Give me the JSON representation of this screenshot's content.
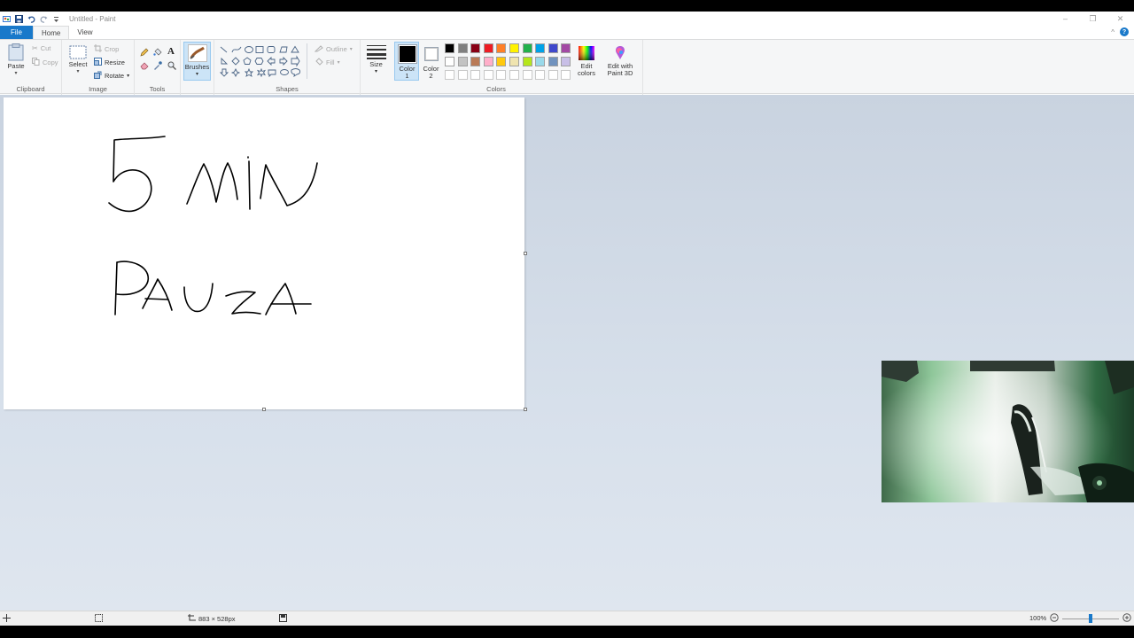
{
  "window": {
    "title": "Untitled - Paint"
  },
  "menu": {
    "file": "File",
    "home": "Home",
    "view": "View"
  },
  "clipboard": {
    "paste": "Paste",
    "cut": "Cut",
    "copy": "Copy",
    "label": "Clipboard"
  },
  "image": {
    "select": "Select",
    "crop": "Crop",
    "resize": "Resize",
    "rotate": "Rotate",
    "label": "Image"
  },
  "tools": {
    "label": "Tools"
  },
  "brushes": {
    "label": "Brushes"
  },
  "shapes": {
    "outline": "Outline",
    "fill": "Fill",
    "label": "Shapes"
  },
  "size": {
    "label": "Size"
  },
  "colors": {
    "color1_label": "Color",
    "color1_num": "1",
    "color2_label": "Color",
    "color2_num": "2",
    "edit_colors_l1": "Edit",
    "edit_colors_l2": "colors",
    "paint3d_l1": "Edit with",
    "paint3d_l2": "Paint 3D",
    "label": "Colors",
    "color1_value": "#000000",
    "color2_value": "#ffffff",
    "palette_row1": [
      "#000000",
      "#7f7f7f",
      "#880015",
      "#ed1c24",
      "#ff7f27",
      "#fff200",
      "#22b14c",
      "#00a2e8",
      "#3f48cc",
      "#a349a4"
    ],
    "palette_row2": [
      "#ffffff",
      "#c3c3c3",
      "#b97a57",
      "#ffaec9",
      "#ffc90e",
      "#efe4b0",
      "#b5e61d",
      "#99d9ea",
      "#7092be",
      "#c8bfe7"
    ]
  },
  "status": {
    "dimensions": "883 × 528px",
    "zoom": "100%"
  }
}
